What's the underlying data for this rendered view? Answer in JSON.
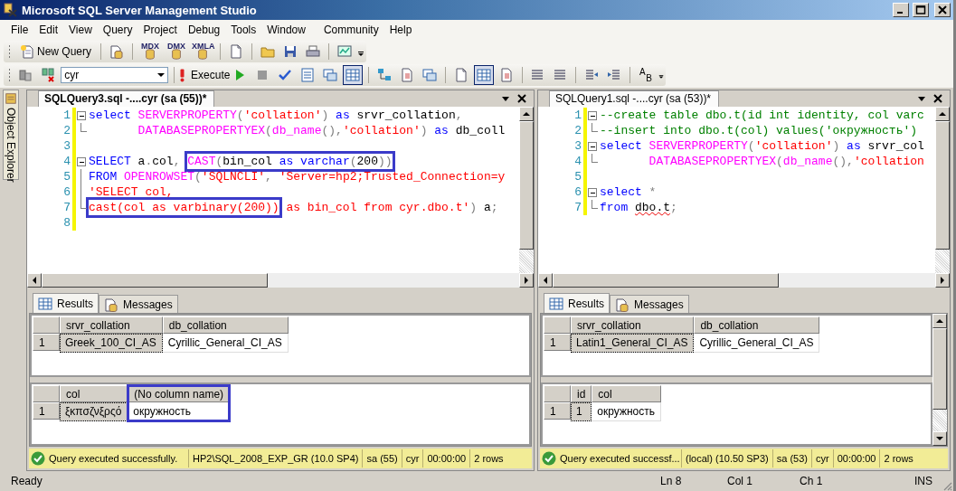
{
  "window": {
    "title": "Microsoft SQL Server Management Studio"
  },
  "menu": [
    "File",
    "Edit",
    "View",
    "Query",
    "Project",
    "Debug",
    "Tools",
    "Window",
    "Community",
    "Help"
  ],
  "toolbar_standard": {
    "new_query": "New Query",
    "query_types": [
      "MDX",
      "DMX",
      "XMLA"
    ]
  },
  "toolbar_query": {
    "database": "cyr",
    "execute": "Execute",
    "output_modes": [
      {
        "selected": false
      },
      {
        "selected": false
      },
      {
        "selected": true
      }
    ],
    "options": [
      {
        "selected": false
      },
      {
        "selected": true
      },
      {
        "selected": false
      }
    ],
    "letters": [
      "A",
      "B"
    ]
  },
  "side_tab": "Object Explorer",
  "panes": [
    {
      "tab": "SQLQuery3.sql -....cyr (sa (55))*",
      "lines": [
        {
          "n": "1",
          "kind": "fold_start",
          "changed": true,
          "parts": [
            {
              "t": "select ",
              "kind": "kw"
            },
            {
              "t": "SERVERPROPERTY",
              "kind": "fn"
            },
            {
              "t": "(",
              "kind": "op"
            },
            {
              "t": "'collation'",
              "kind": "str"
            },
            {
              "t": ")",
              "kind": "op"
            },
            {
              "t": " as",
              "kind": "kw"
            },
            {
              "t": " srvr_collation",
              "kind": "id"
            },
            {
              "t": ",",
              "kind": "op"
            }
          ]
        },
        {
          "n": "2",
          "kind": "fold_end",
          "changed": true,
          "parts": [
            {
              "t": "       DATABASEPROPERTYEX",
              "kind": "fn"
            },
            {
              "t": "(",
              "kind": "op"
            },
            {
              "t": "db_name",
              "kind": "fn"
            },
            {
              "t": "(),",
              "kind": "op"
            },
            {
              "t": "'collation'",
              "kind": "str"
            },
            {
              "t": ")",
              "kind": "op"
            },
            {
              "t": " as",
              "kind": "kw"
            },
            {
              "t": " db_coll",
              "kind": "id"
            }
          ]
        },
        {
          "n": "3",
          "kind": "plain",
          "changed": true
        },
        {
          "n": "4",
          "kind": "fold_start",
          "changed": true,
          "parts": [
            {
              "t": "SELECT",
              "kind": "kw"
            },
            {
              "t": " a",
              "kind": "id"
            },
            {
              "t": ".",
              "kind": "op"
            },
            {
              "t": "col",
              "kind": "id"
            },
            {
              "t": ", ",
              "kind": "op"
            },
            {
              "kind": "box",
              "parts": [
                {
                  "t": "CAST",
                  "kind": "fn"
                },
                {
                  "t": "(",
                  "kind": "op"
                },
                {
                  "t": "bin_col ",
                  "kind": "id"
                },
                {
                  "t": "as varchar",
                  "kind": "kw"
                },
                {
                  "t": "(",
                  "kind": "op"
                },
                {
                  "t": "200",
                  "kind": "id"
                },
                {
                  "t": "))",
                  "kind": "op"
                }
              ]
            }
          ]
        },
        {
          "n": "5",
          "kind": "fold_body",
          "changed": true,
          "parts": [
            {
              "t": "FROM ",
              "kind": "kw"
            },
            {
              "t": "OPENROWSET",
              "kind": "fn"
            },
            {
              "t": "(",
              "kind": "op"
            },
            {
              "t": "'SQLNCLI'",
              "kind": "str"
            },
            {
              "t": ", ",
              "kind": "op"
            },
            {
              "t": "'Server=hp2;Trusted_Connection=y",
              "kind": "str"
            }
          ]
        },
        {
          "n": "6",
          "kind": "fold_body",
          "changed": true,
          "parts": [
            {
              "t": "'SELECT col,",
              "kind": "str"
            }
          ]
        },
        {
          "n": "7",
          "kind": "fold_end",
          "changed": true,
          "parts": [
            {
              "kind": "box",
              "parts": [
                {
                  "t": "cast(col as varbinary(200))",
                  "kind": "str"
                }
              ]
            },
            {
              "t": " as bin_col from cyr.dbo.t'",
              "kind": "str"
            },
            {
              "t": ")",
              "kind": "op"
            },
            {
              "t": " a",
              "kind": "id"
            },
            {
              "t": ";",
              "kind": "op"
            }
          ]
        },
        {
          "n": "8",
          "kind": "plain",
          "changed": true
        }
      ],
      "result_tabs": [
        {
          "label": "Results",
          "selected": true
        },
        {
          "label": "Messages",
          "selected": false
        }
      ],
      "results_scrollbar": false,
      "grids": [
        {
          "row_numbers": [
            "1"
          ],
          "columns": [
            {
              "name": "srvr_collation",
              "highlighted": false,
              "cells": [
                {
                  "text": "Greek_100_CI_AS",
                  "selected": true
                }
              ]
            },
            {
              "name": "db_collation",
              "highlighted": false,
              "cells": [
                {
                  "text": "Cyrillic_General_CI_AS",
                  "selected": false
                }
              ]
            }
          ]
        },
        {
          "row_numbers": [
            "1"
          ],
          "columns": [
            {
              "name": "col",
              "highlighted": false,
              "cells": [
                {
                  "text": "ξκπσζνξρςό",
                  "selected": true
                }
              ]
            },
            {
              "name": "(No column name)",
              "highlighted": true,
              "cells": [
                {
                  "text": "окружность",
                  "selected": false
                }
              ]
            }
          ]
        }
      ],
      "status": {
        "message": "Query executed successfully.",
        "fields": [
          "HP2\\SQL_2008_EXP_GR (10.0 SP4)",
          "sa (55)",
          "cyr",
          "00:00:00",
          "2 rows"
        ]
      }
    },
    {
      "tab": "SQLQuery1.sql -....cyr (sa (53))*",
      "lines": [
        {
          "n": "1",
          "kind": "fold_start",
          "changed": true,
          "parts": [
            {
              "t": "--create table dbo.t(id int identity, col varc",
              "kind": "comment"
            }
          ]
        },
        {
          "n": "2",
          "kind": "fold_end",
          "changed": true,
          "parts": [
            {
              "t": "--insert into dbo.t(col) values('окружность')",
              "kind": "comment"
            }
          ]
        },
        {
          "n": "3",
          "kind": "fold_start",
          "changed": true,
          "parts": [
            {
              "t": "select ",
              "kind": "kw"
            },
            {
              "t": "SERVERPROPERTY",
              "kind": "fn"
            },
            {
              "t": "(",
              "kind": "op"
            },
            {
              "t": "'collation'",
              "kind": "str"
            },
            {
              "t": ")",
              "kind": "op"
            },
            {
              "t": " as",
              "kind": "kw"
            },
            {
              "t": " srvr_col",
              "kind": "id"
            }
          ]
        },
        {
          "n": "4",
          "kind": "fold_end",
          "changed": true,
          "parts": [
            {
              "t": "       DATABASEPROPERTYEX",
              "kind": "fn"
            },
            {
              "t": "(",
              "kind": "op"
            },
            {
              "t": "db_name",
              "kind": "fn"
            },
            {
              "t": "(),",
              "kind": "op"
            },
            {
              "t": "'collation",
              "kind": "str"
            }
          ]
        },
        {
          "n": "5",
          "kind": "plain",
          "changed": true
        },
        {
          "n": "6",
          "kind": "fold_start",
          "changed": true,
          "parts": [
            {
              "t": "select ",
              "kind": "kw"
            },
            {
              "t": "*",
              "kind": "op"
            }
          ]
        },
        {
          "n": "7",
          "kind": "fold_end",
          "changed": true,
          "parts": [
            {
              "t": "from ",
              "kind": "kw"
            },
            {
              "t": "dbo.t",
              "kind": "err"
            },
            {
              "t": ";",
              "kind": "op"
            }
          ]
        }
      ],
      "result_tabs": [
        {
          "label": "Results",
          "selected": true
        },
        {
          "label": "Messages",
          "selected": false
        }
      ],
      "results_scrollbar": true,
      "grids": [
        {
          "row_numbers": [
            "1"
          ],
          "columns": [
            {
              "name": "srvr_collation",
              "highlighted": false,
              "cells": [
                {
                  "text": "Latin1_General_CI_AS",
                  "selected": true
                }
              ]
            },
            {
              "name": "db_collation",
              "highlighted": false,
              "cells": [
                {
                  "text": "Cyrillic_General_CI_AS",
                  "selected": false
                }
              ]
            }
          ]
        },
        {
          "row_numbers": [
            "1"
          ],
          "columns": [
            {
              "name": "id",
              "highlighted": false,
              "cells": [
                {
                  "text": "1",
                  "selected": true
                }
              ]
            },
            {
              "name": "col",
              "highlighted": false,
              "cells": [
                {
                  "text": "окружность",
                  "selected": false
                }
              ]
            }
          ]
        }
      ],
      "status": {
        "message": "Query executed successf...",
        "fields": [
          "(local) (10.50 SP3)",
          "sa (53)",
          "cyr",
          "00:00:00",
          "2 rows"
        ]
      }
    }
  ],
  "status_bar": {
    "message": "Ready",
    "fields": [
      "Ln 8",
      "Col 1",
      "Ch 1",
      "INS"
    ]
  }
}
